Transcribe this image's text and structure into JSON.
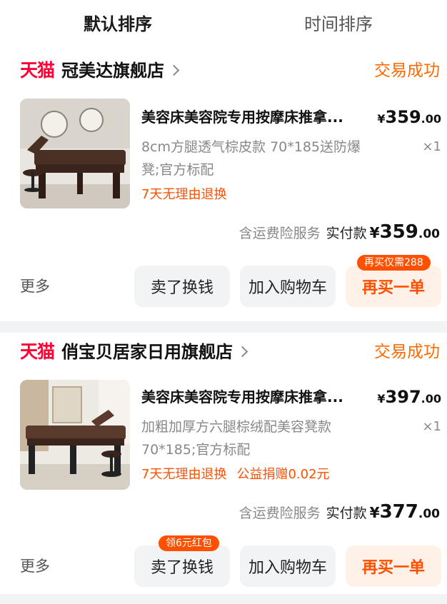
{
  "sort": {
    "default_label": "默认排序",
    "time_label": "时间排序"
  },
  "orders": [
    {
      "platform_logo": "天猫",
      "store_name": "冠美达旗舰店",
      "status": "交易成功",
      "product": {
        "title": "美容床美容院专用按摩床推拿...",
        "price_currency": "¥",
        "price_int": "359",
        "price_dec": ".00",
        "spec": "8cm方腿透气棕皮款 70*185送防爆凳;官方标配",
        "quantity": "×1",
        "tags": [
          "7天无理由退换"
        ]
      },
      "total": {
        "shipping_note": "含运费险服务",
        "label": "实付款",
        "currency": "¥",
        "int": "359",
        "dec": ".00"
      },
      "actions": {
        "more": "更多",
        "sell": "卖了换钱",
        "cart": "加入购物车",
        "buy_again": "再买一单",
        "badge": "再买仅需288"
      }
    },
    {
      "platform_logo": "天猫",
      "store_name": "俏宝贝居家日用旗舰店",
      "status": "交易成功",
      "product": {
        "title": "美容床美容院专用按摩床推拿...",
        "price_currency": "¥",
        "price_int": "397",
        "price_dec": ".00",
        "spec": "加粗加厚方六腿棕绒配美容凳款 70*185;官方标配",
        "quantity": "×1",
        "tags": [
          "7天无理由退换",
          "公益捐赠0.02元"
        ]
      },
      "total": {
        "shipping_note": "含运费险服务",
        "label": "实付款",
        "currency": "¥",
        "int": "377",
        "dec": ".00"
      },
      "actions": {
        "more": "更多",
        "sell": "卖了换钱",
        "cart": "加入购物车",
        "buy_again": "再买一单",
        "badge": "领6元红包"
      }
    }
  ],
  "colors": {
    "tmall_red": "#ff0036",
    "accent_orange": "#ff5000",
    "status_orange": "#ff6a00",
    "bed_brown": "#4a2f24"
  }
}
